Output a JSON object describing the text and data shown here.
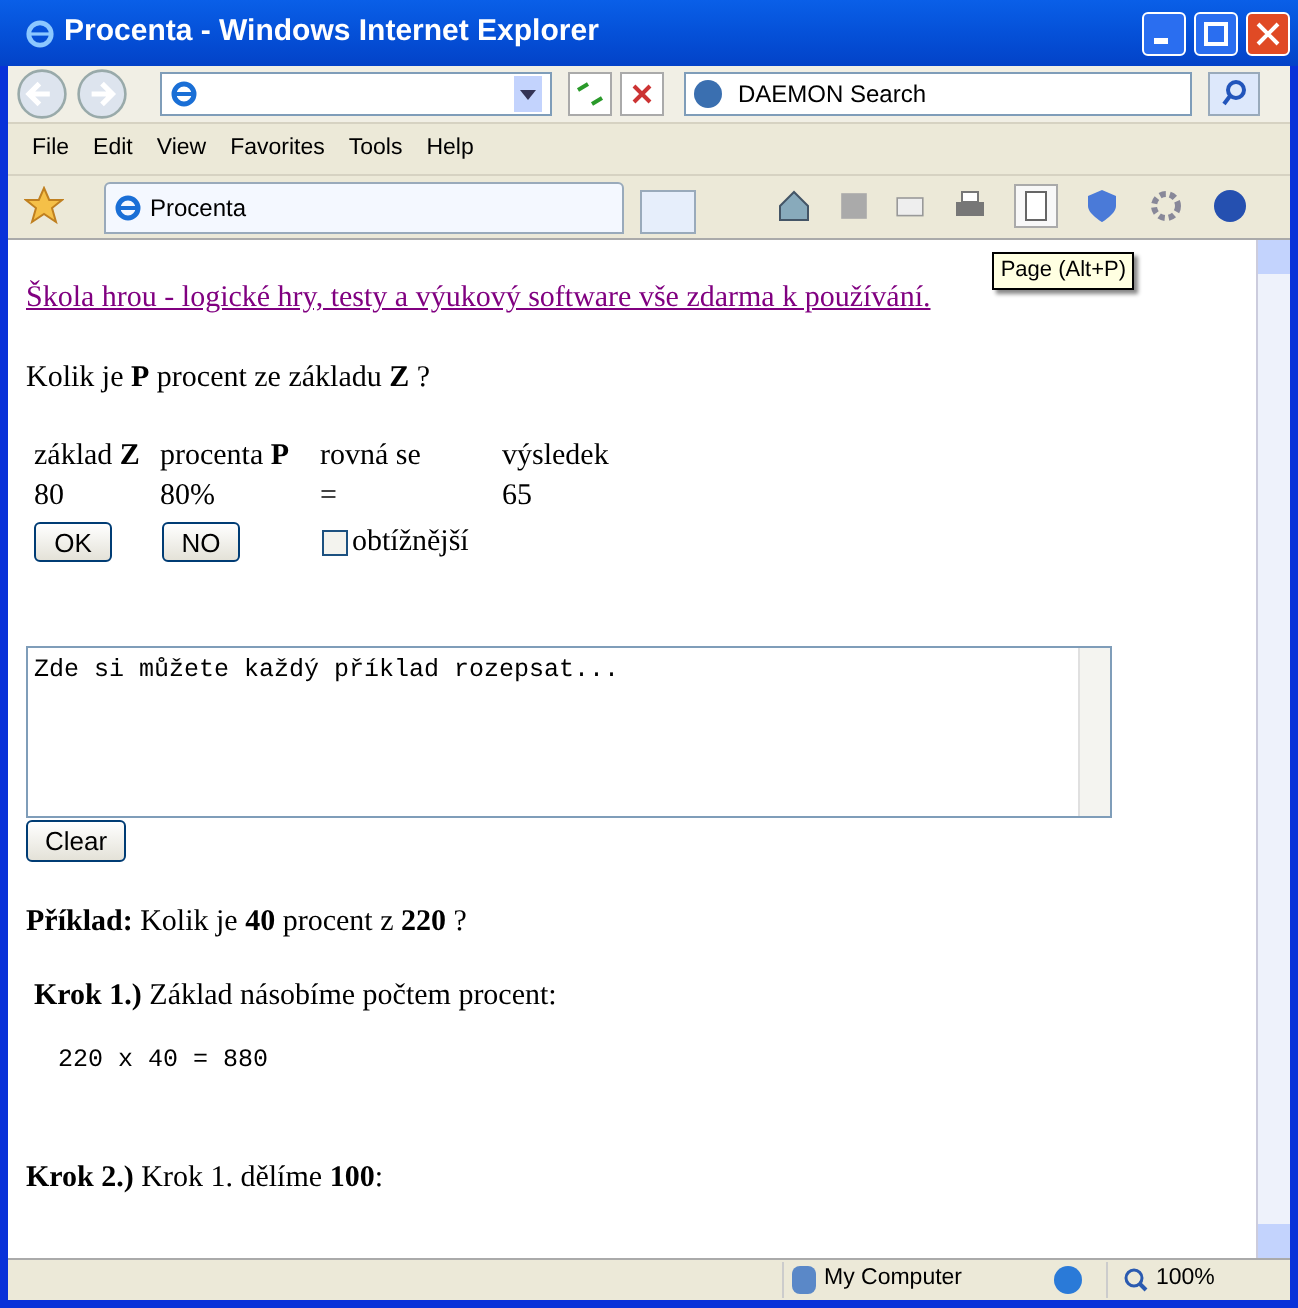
{
  "window": {
    "title": "Procenta - Windows Internet Explorer"
  },
  "search": {
    "value": "DAEMON Search"
  },
  "menu": [
    "File",
    "Edit",
    "View",
    "Favorites",
    "Tools",
    "Help"
  ],
  "tabs": [
    {
      "label": "Procenta",
      "selected": true
    }
  ],
  "tooltip": "Page (Alt+P)",
  "page": {
    "link": "Škola hrou - logické hry, testy a výukový software vše zdarma k používání.",
    "question": "Kolik je **P** procent ze základu **Z** ?",
    "table": {
      "headers": [
        "základ **Z**",
        "procenta **P**",
        "rovná se",
        "výsledek"
      ],
      "values": [
        "80",
        "80%",
        "=",
        "65"
      ]
    },
    "buttons": [
      "OK",
      "NO"
    ],
    "checkbox": {
      "label": "obtížnější",
      "checked": false
    },
    "textarea": {
      "placeholder": "Zde si můžete každý příklad rozepsat..."
    },
    "clear_button": "Clear",
    "example": "**Příklad:** Kolik je **40** procent z **220** ?",
    "steps": [
      {
        "text": "**Krok 1.)** Základ násobíme počtem procent:",
        "formula": "220 x 40 = 880"
      },
      {
        "text": "**Krok 2.)** Krok 1. dělíme **100**:"
      }
    ]
  },
  "status_bar": {
    "zone": "My Computer",
    "zoom": "100%"
  }
}
